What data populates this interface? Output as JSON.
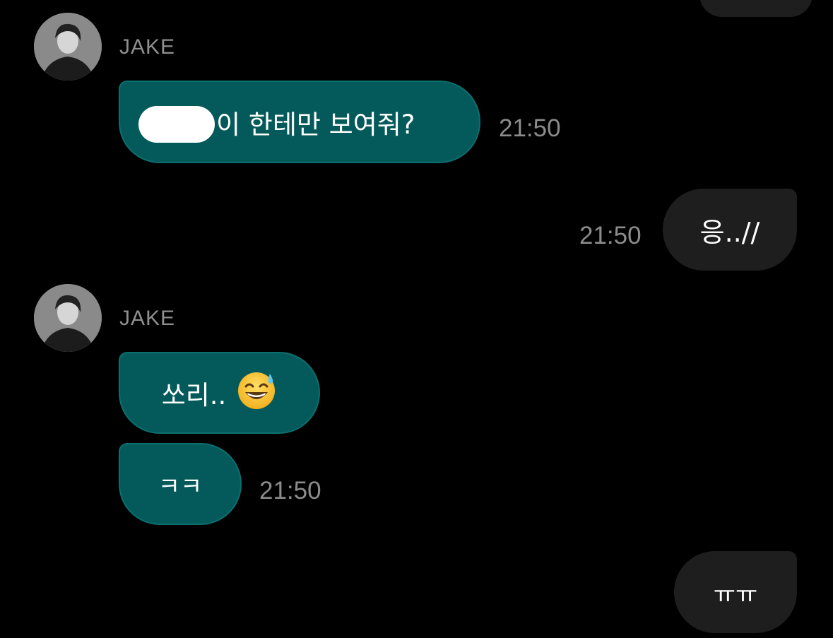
{
  "conversation": {
    "partner_name": "JAKE",
    "messages": [
      {
        "from": "partner",
        "text": "이 한테만 보여줘?",
        "time": "21:50"
      },
      {
        "from": "me",
        "text": "응..//",
        "time": "21:50"
      },
      {
        "from": "partner",
        "text": "쏘리..",
        "emoji": "sweat-smile-emoji"
      },
      {
        "from": "partner",
        "text": "ㅋㅋ",
        "time": "21:50"
      },
      {
        "from": "me",
        "text": "ㅠㅠ"
      }
    ]
  },
  "colors": {
    "background": "#000000",
    "incoming_bubble": "#045a5a",
    "outgoing_bubble": "#1e1e1e",
    "timestamp": "#8c8c8c",
    "name": "#8f8f8f"
  }
}
